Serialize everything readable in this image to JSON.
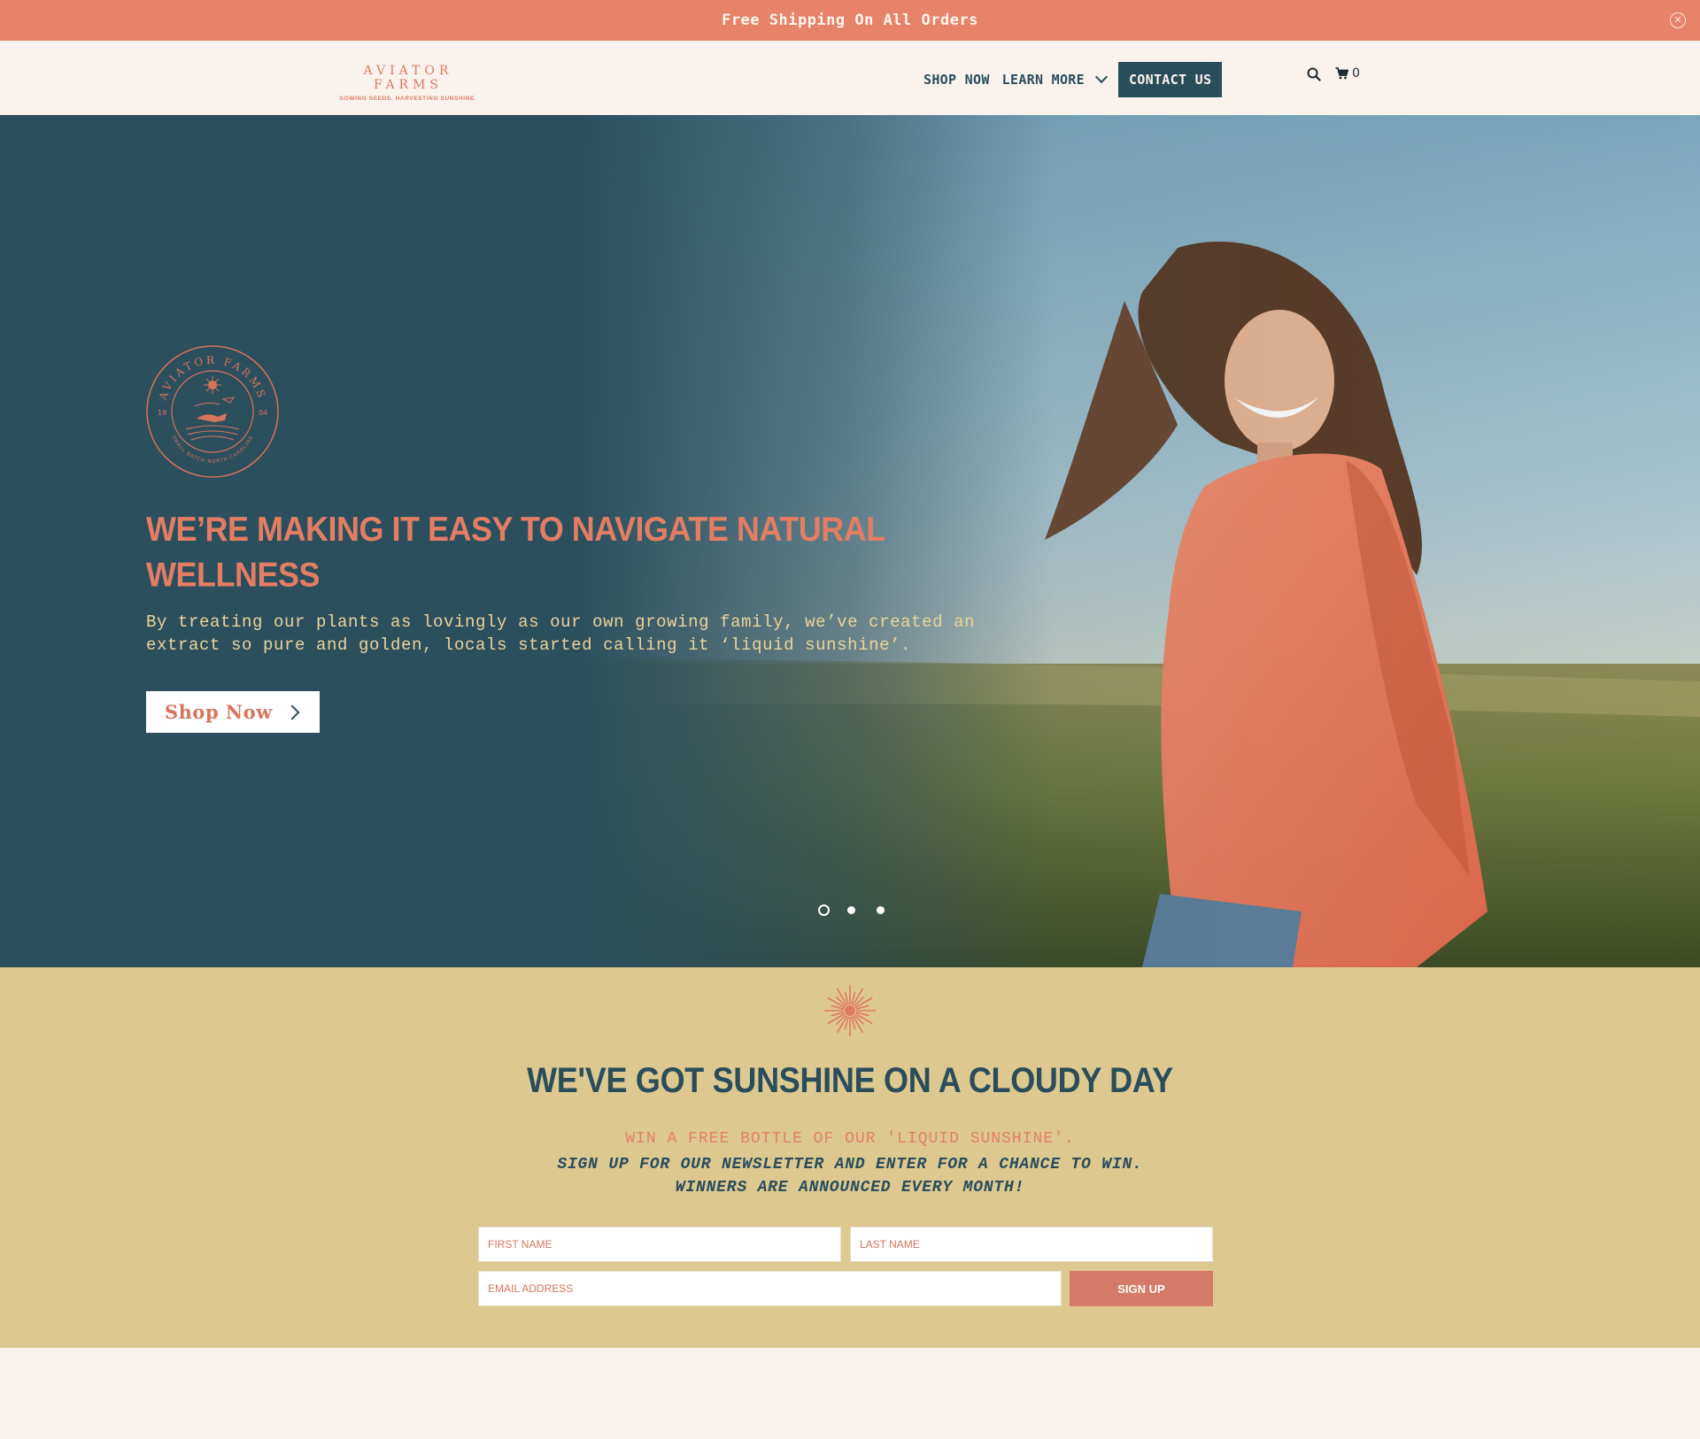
{
  "announcement": {
    "text": "Free Shipping On All Orders"
  },
  "header": {
    "logo_title": "AVIATOR FARMS",
    "logo_tagline": "SOWING SEEDS. HARVESTING SUNSHINE.",
    "nav": {
      "shop_now": "SHOP NOW",
      "learn_more": "LEARN MORE",
      "contact": "CONTACT US"
    },
    "cart_count": "0"
  },
  "hero": {
    "badge": {
      "arc_top": "AVIATOR FARMS",
      "left_num": "19",
      "right_num": "04",
      "arc_bottom": "SMALL BATCH NORTH CAROLINA"
    },
    "title_line1": "WE’RE MAKING IT EASY TO NAVIGATE NATURAL",
    "title_line2": "WELLNESS",
    "subtitle_line1": "By treating our plants as lovingly as our own growing family, we’ve created an",
    "subtitle_line2": "extract so pure and golden, locals started calling it ‘liquid sunshine’.",
    "button_label": "Shop Now",
    "slides": 3,
    "active_slide": 1
  },
  "newsletter": {
    "title": "WE'VE GOT SUNSHINE ON A CLOUDY DAY",
    "line1": "WIN A FREE BOTTLE OF OUR 'LIQUID SUNSHINE'.",
    "line2": "SIGN UP FOR OUR NEWSLETTER AND ENTER FOR A CHANCE TO WIN.",
    "line3": "WINNERS ARE ANNOUNCED EVERY MONTH!",
    "first_name_placeholder": "FIRST NAME",
    "last_name_placeholder": "LAST NAME",
    "email_placeholder": "EMAIL ADDRESS",
    "signup_label": "SIGN UP"
  },
  "colors": {
    "coral": "#e68368",
    "teal": "#2a4d5c",
    "sand": "#ddc890",
    "cream": "#faf3ed"
  }
}
